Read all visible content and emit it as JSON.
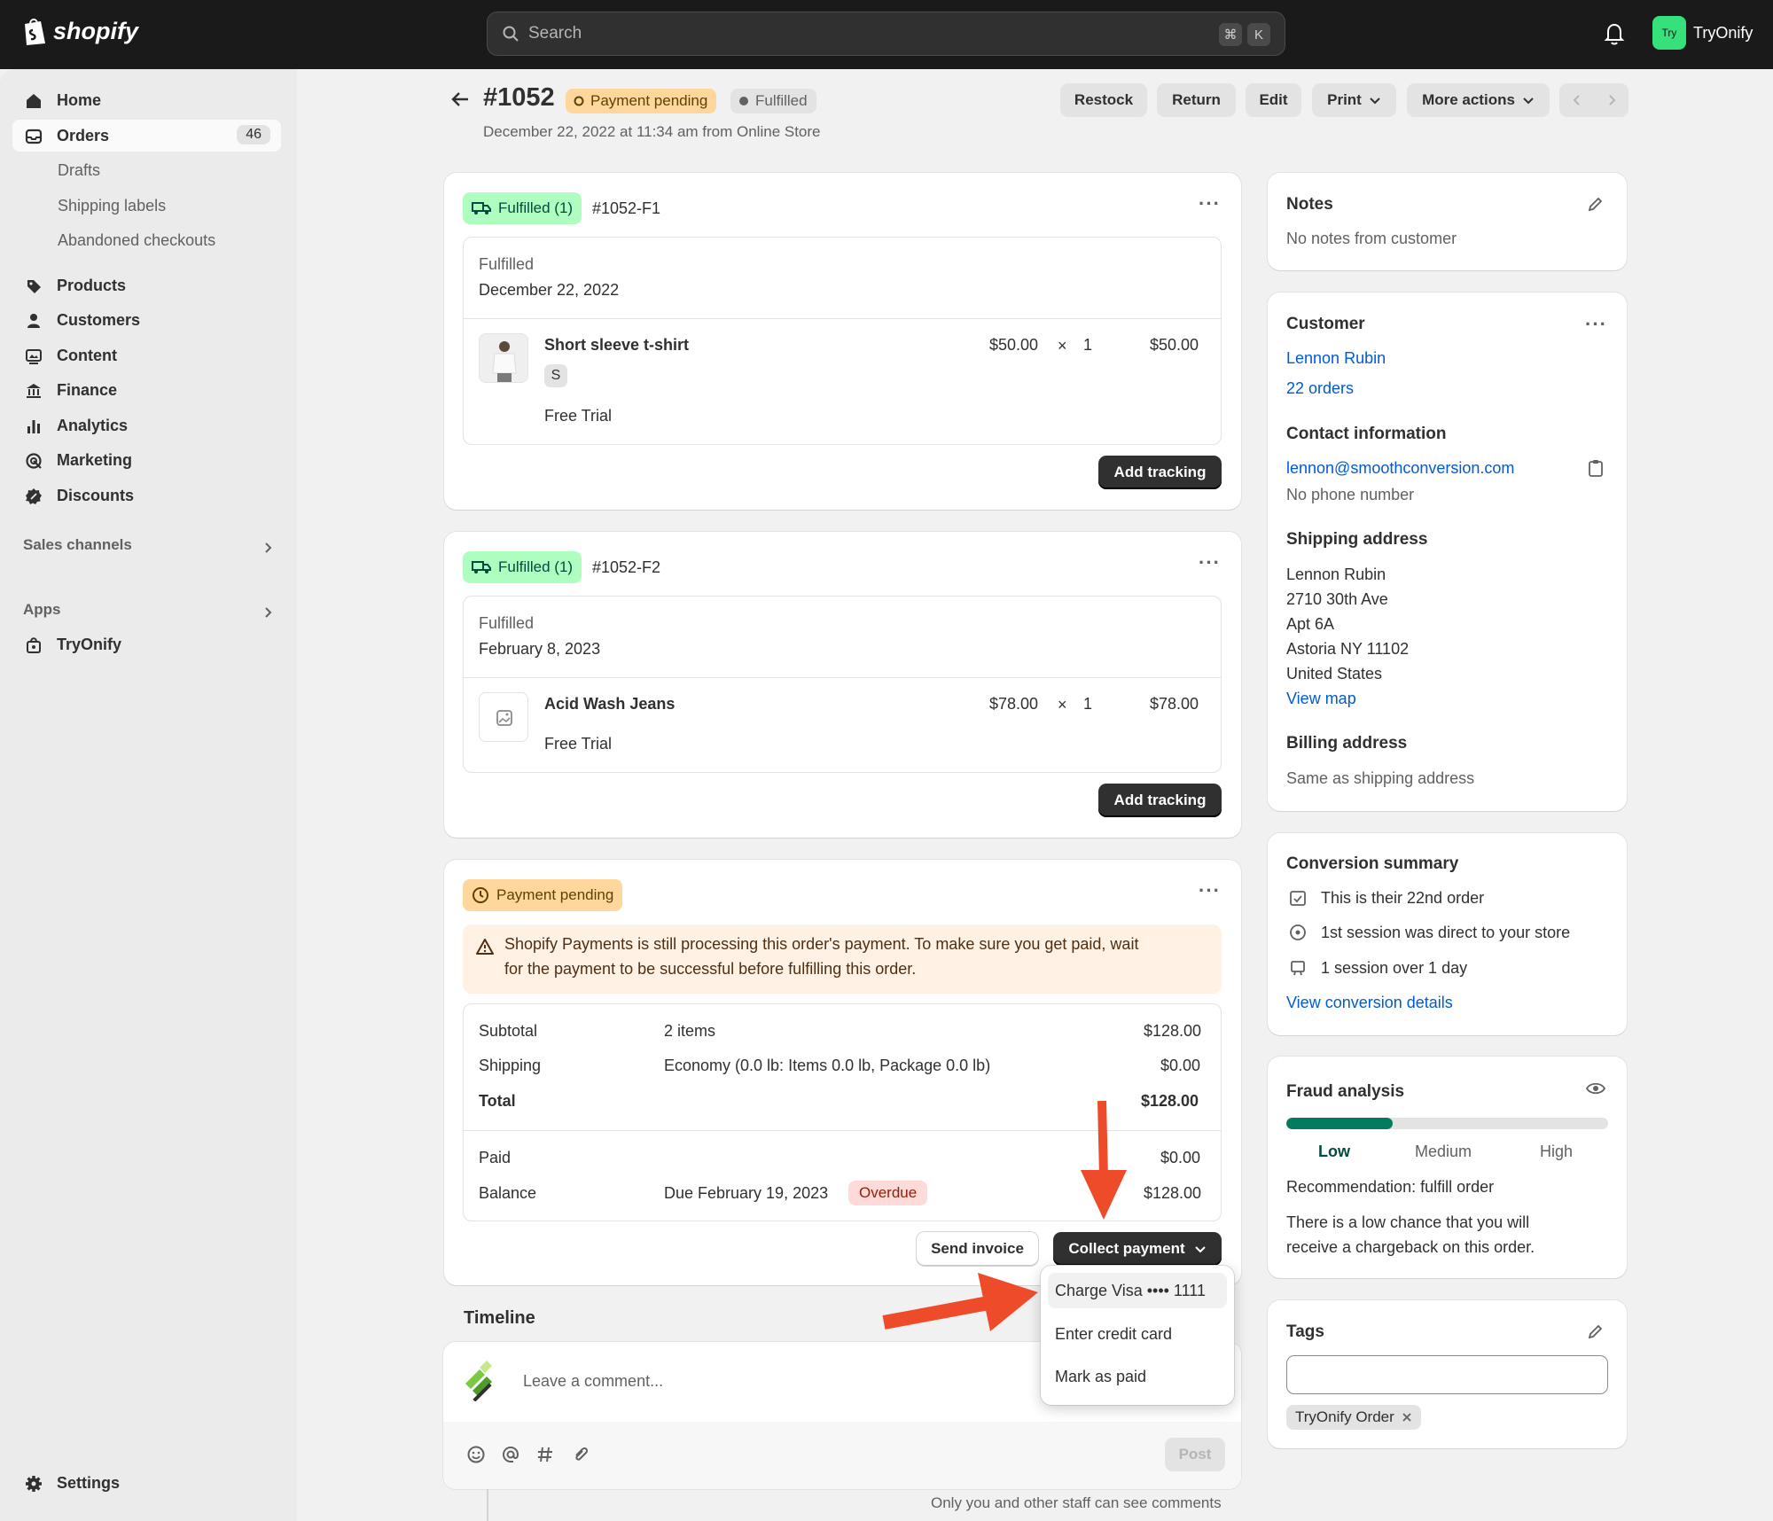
{
  "topbar": {
    "brand": "shopify",
    "search_placeholder": "Search",
    "shortcut_key1": "⌘",
    "shortcut_key2": "K",
    "store_avatar": "Try",
    "store_name": "TryOnify"
  },
  "sidebar": {
    "home": "Home",
    "orders": "Orders",
    "orders_count": "46",
    "drafts": "Drafts",
    "shipping_labels": "Shipping labels",
    "abandoned_checkouts": "Abandoned checkouts",
    "products": "Products",
    "customers": "Customers",
    "content": "Content",
    "finance": "Finance",
    "analytics": "Analytics",
    "marketing": "Marketing",
    "discounts": "Discounts",
    "sales_channels": "Sales channels",
    "apps": "Apps",
    "tryonify": "TryOnify",
    "settings": "Settings"
  },
  "header": {
    "order_number": "#1052",
    "payment_badge": "Payment pending",
    "fulfillment_badge": "Fulfilled",
    "subtitle": "December 22, 2022 at 11:34 am from Online Store",
    "restock": "Restock",
    "return": "Return",
    "edit": "Edit",
    "print": "Print",
    "more_actions": "More actions"
  },
  "fulfillment1": {
    "badge": "Fulfilled (1)",
    "id": "#1052-F1",
    "status_label": "Fulfilled",
    "date": "December 22, 2022",
    "product": "Short sleeve t-shirt",
    "variant": "S",
    "plan": "Free Trial",
    "price": "$50.00",
    "times": "×",
    "qty": "1",
    "total": "$50.00",
    "button": "Add tracking"
  },
  "fulfillment2": {
    "badge": "Fulfilled (1)",
    "id": "#1052-F2",
    "status_label": "Fulfilled",
    "date": "February 8, 2023",
    "product": "Acid Wash Jeans",
    "plan": "Free Trial",
    "price": "$78.00",
    "times": "×",
    "qty": "1",
    "total": "$78.00",
    "button": "Add tracking"
  },
  "payment": {
    "badge": "Payment pending",
    "warning_line1": "Shopify Payments is still processing this order's payment. To make sure you get paid, wait",
    "warning_line2": "for the payment to be successful before fulfilling this order.",
    "subtotal_label": "Subtotal",
    "subtotal_desc": "2 items",
    "subtotal_value": "$128.00",
    "shipping_label": "Shipping",
    "shipping_desc": "Economy (0.0 lb: Items 0.0 lb, Package 0.0 lb)",
    "shipping_value": "$0.00",
    "total_label": "Total",
    "total_value": "$128.00",
    "paid_label": "Paid",
    "paid_value": "$0.00",
    "balance_label": "Balance",
    "balance_due": "Due February 19, 2023",
    "overdue": "Overdue",
    "balance_value": "$128.00",
    "send_invoice": "Send invoice",
    "collect_payment": "Collect payment"
  },
  "collect_menu": {
    "charge": "Charge Visa •••• 1111",
    "enter_card": "Enter credit card",
    "mark_paid": "Mark as paid"
  },
  "timeline": {
    "title": "Timeline",
    "placeholder": "Leave a comment...",
    "post": "Post",
    "note": "Only you and other staff can see comments"
  },
  "notes": {
    "title": "Notes",
    "text": "No notes from customer"
  },
  "customer": {
    "title": "Customer",
    "name": "Lennon Rubin",
    "orders": "22 orders",
    "contact_title": "Contact information",
    "email": "lennon@smoothconversion.com",
    "phone": "No phone number",
    "shipping_title": "Shipping address",
    "ship_line1": "Lennon Rubin",
    "ship_line2": "2710 30th Ave",
    "ship_line3": "Apt 6A",
    "ship_line4": "Astoria NY 11102",
    "ship_line5": "United States",
    "view_map": "View map",
    "billing_title": "Billing address",
    "billing_text": "Same as shipping address"
  },
  "conversion": {
    "title": "Conversion summary",
    "line1": "This is their 22nd order",
    "line2": "1st session was direct to your store",
    "line3": "1 session over 1 day",
    "link": "View conversion details"
  },
  "fraud": {
    "title": "Fraud analysis",
    "level_fraction": 0.33,
    "low": "Low",
    "medium": "Medium",
    "high": "High",
    "recommendation": "Recommendation: fulfill order",
    "desc_line1": "There is a low chance that you will",
    "desc_line2": "receive a chargeback on this order."
  },
  "tags": {
    "title": "Tags",
    "tag1": "TryOnify Order"
  },
  "colors": {
    "annotation_arrow": "#ee4b2b",
    "brand_green": "#36e07a"
  }
}
